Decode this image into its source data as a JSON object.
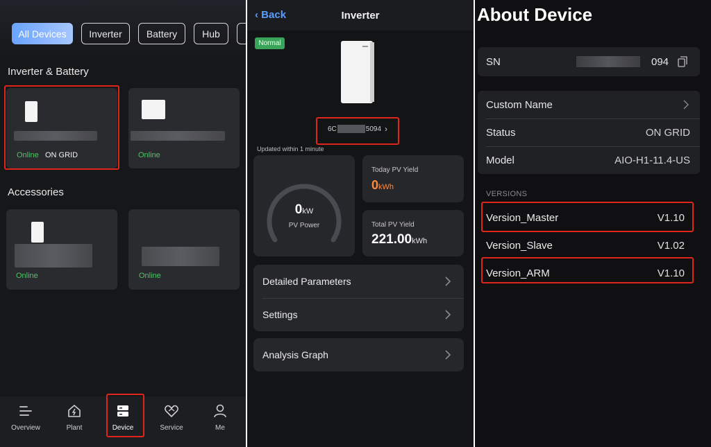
{
  "device_list": {
    "filters": [
      "All Devices",
      "Inverter",
      "Battery",
      "Hub"
    ],
    "section_inverter_battery": "Inverter & Battery",
    "section_accessories": "Accessories",
    "cards": [
      {
        "status": "Online",
        "grid": "ON GRID"
      },
      {
        "status": "Online"
      },
      {
        "status": "Online"
      },
      {
        "status": "Online"
      }
    ],
    "tabs": [
      "Overview",
      "Plant",
      "Device",
      "Service",
      "Me"
    ]
  },
  "inverter": {
    "back_label": "Back",
    "title": "Inverter",
    "badge": "Normal",
    "sn_prefix": "6C",
    "sn_suffix": "5094",
    "updated": "Updated  within 1 minute",
    "pv_power_value": "0",
    "pv_power_unit": "kW",
    "pv_power_label": "PV Power",
    "today_label": "Today PV Yield",
    "today_value": "0",
    "today_unit": "kWh",
    "total_label": "Total PV Yield",
    "total_value": "221.00",
    "total_unit": "kWh",
    "menu": [
      "Detailed Parameters",
      "Settings"
    ],
    "analysis": "Analysis Graph",
    "colors": {
      "accent": "#5a9cff",
      "today": "#ff8a3d",
      "online": "#4fc36a",
      "highlight": "#e0251b"
    }
  },
  "about": {
    "title": "About Device",
    "sn_label": "SN",
    "sn_suffix": "094",
    "custom_name_label": "Custom Name",
    "status_label": "Status",
    "status_value": "ON GRID",
    "model_label": "Model",
    "model_value": "AIO-H1-11.4-US",
    "versions_heading": "VERSIONS",
    "versions": [
      {
        "label": "Version_Master",
        "value": "V1.10"
      },
      {
        "label": "Version_Slave",
        "value": "V1.02"
      },
      {
        "label": "Version_ARM",
        "value": "V1.10"
      }
    ]
  }
}
